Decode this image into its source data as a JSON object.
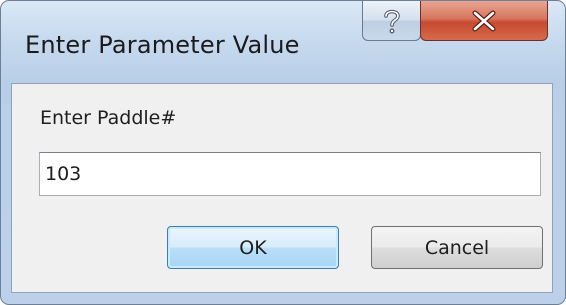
{
  "window": {
    "title": "Enter Parameter Value",
    "help_icon": "question-mark-icon",
    "close_icon": "close-x-icon",
    "close_color": "#c74a30",
    "title_bar_color": "#c6d9ee"
  },
  "dialog": {
    "prompt": "Enter Paddle#",
    "input_value": "103",
    "ok_label": "OK",
    "cancel_label": "Cancel"
  }
}
